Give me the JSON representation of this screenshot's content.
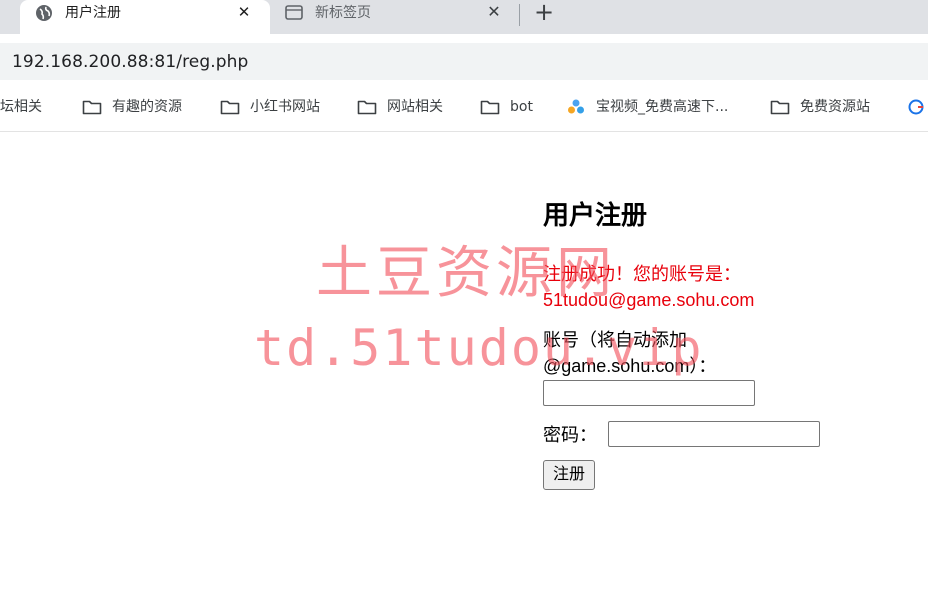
{
  "tabs": [
    {
      "title": "用户注册",
      "close": "✕"
    },
    {
      "title": "新标签页",
      "close": "✕"
    }
  ],
  "new_tab": "+",
  "address_bar": {
    "url": "192.168.200.88:81/reg.php"
  },
  "bookmarks": [
    {
      "label": "论坛相关",
      "icon": "folder-icon"
    },
    {
      "label": "有趣的资源",
      "icon": "folder-icon"
    },
    {
      "label": "小红书网站",
      "icon": "folder-icon"
    },
    {
      "label": "网站相关",
      "icon": "folder-icon"
    },
    {
      "label": "bot",
      "icon": "folder-icon"
    },
    {
      "label": "宝视频_免费高速下...",
      "icon": "site-favicon-icon"
    },
    {
      "label": "免费资源站",
      "icon": "folder-icon"
    }
  ],
  "form": {
    "title": "用户注册",
    "success_message": "注册成功！您的账号是：51tudou@game.sohu.com",
    "account_label": "账号（将自动添加@game.sohu.com）：",
    "account_value": "",
    "password_label": "密码：",
    "password_value": "",
    "submit_label": "注册"
  },
  "watermark": {
    "line1": "土豆资源网",
    "line2": "td.51tudou.vip"
  },
  "colors": {
    "success": "#e8000b",
    "watermark": "#f2505c",
    "tabstrip": "#dfe1e5",
    "omnibox": "#f1f3f4"
  }
}
